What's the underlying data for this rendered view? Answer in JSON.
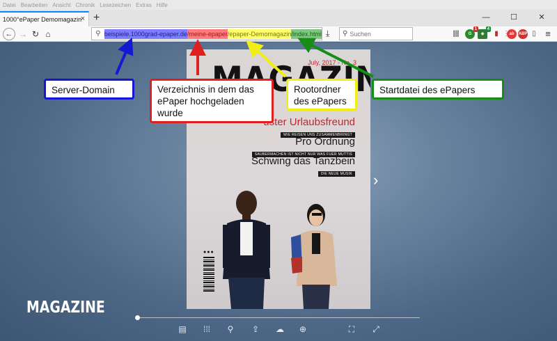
{
  "menubar": [
    "Datei",
    "Bearbeiten",
    "Ansicht",
    "Chronik",
    "Lesezeichen",
    "Extras",
    "Hilfe"
  ],
  "tab": {
    "title": "1000°ePaper Demomagazin",
    "close": "×",
    "new": "+"
  },
  "window_controls": {
    "minimize": "—",
    "maximize": "☐",
    "close": "✕"
  },
  "nav": {
    "back": "←",
    "forward": "→",
    "reload": "↻",
    "home": "⌂"
  },
  "url": {
    "search_glyph": "⚲",
    "domain": "beispiele.1000grad-epaper.de",
    "folder": "/meine-epaper",
    "root": "/epaper-Demomagazin",
    "start": "/index.html"
  },
  "download_glyph": "⤓",
  "search": {
    "placeholder": "Suchen",
    "glyph": "⚲"
  },
  "toolbar_badges": {
    "addon1": "1",
    "addon2": "4"
  },
  "cover": {
    "masthead": "MAGAZINE",
    "issue": "July, 2017 - No. 3",
    "headline1": "uster Urlaubsfreund",
    "sub1": "WIE REISEN UNS ZUSAMMENBRINGT",
    "headline2": "Pro Ordnung",
    "sub2": "SAUBERMACHEN IST NICHT NUR WAS FUER MUTTIS",
    "headline3": "Schwing das Tanzbein",
    "sub3": "DIE NEUE MUSIK",
    "barcode_marks": "●●●"
  },
  "viewer": {
    "next": "›",
    "brand": "MAGAZINE",
    "progress": 0.0
  },
  "viewer_toolbar_glyphs": [
    "▤",
    "⁞⁞⁞",
    "⚲",
    "⇪",
    "☁",
    "⊕",
    "⛶",
    "⤢"
  ],
  "annotations": {
    "server_domain": "Server-Domain",
    "folder_line1": "Verzeichnis in dem das",
    "folder_line2": "ePaper hochgeladen",
    "folder_line3": "wurde",
    "root_line1": "Rootordner",
    "root_line2": "des ePapers",
    "start": "Startdatei des ePapers"
  },
  "colors": {
    "blue": "#1418d2",
    "red": "#e01f1f",
    "yellow": "#f3ee12",
    "green": "#178c17"
  }
}
